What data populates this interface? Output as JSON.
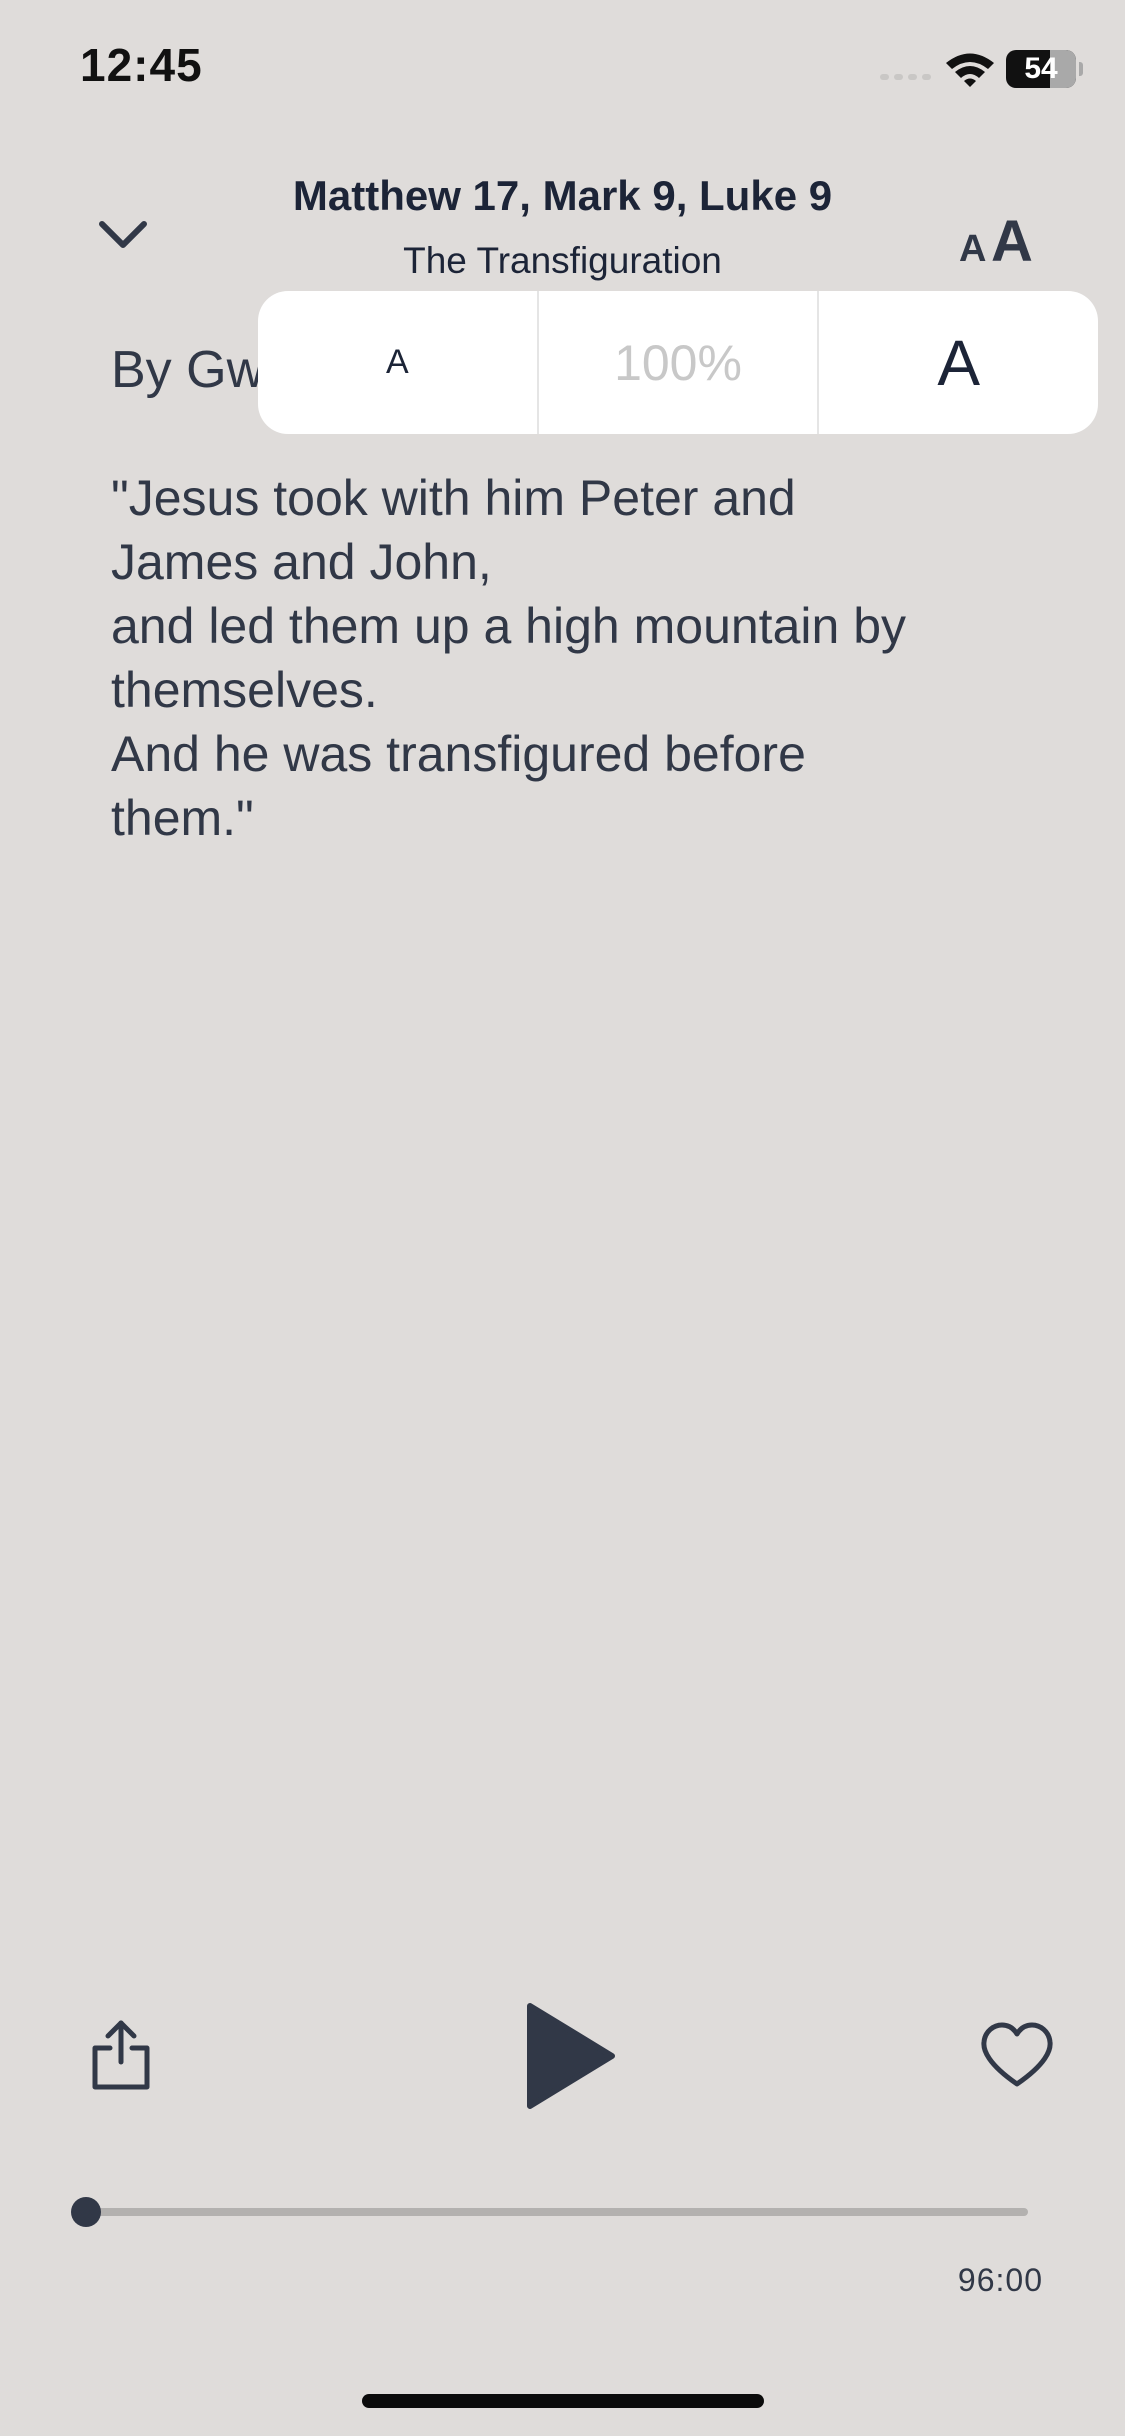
{
  "status_bar": {
    "time": "12:45",
    "battery_level": "54"
  },
  "header": {
    "title": "Matthew 17, Mark 9, Luke 9",
    "subtitle": "The Transfiguration"
  },
  "content": {
    "byline": "By Gw",
    "passage_lines": [
      " \"Jesus took with him Peter and",
      "James and John,",
      "and led them up a high mountain by",
      "themselves.",
      "And he was transfigured before",
      "them.\""
    ]
  },
  "font_popover": {
    "decrease_label": "A",
    "percent_label": "100%",
    "increase_label": "A"
  },
  "player": {
    "progress_fraction": 0,
    "duration": "96:00"
  },
  "icons": {
    "back": "chevron-down-icon",
    "text_size": "text-size-icon",
    "share": "share-icon",
    "play": "play-icon",
    "favorite": "heart-icon"
  },
  "colors": {
    "background": "#dfdcda",
    "text": "#313847",
    "title": "#1c2437",
    "popover_bg": "#ffffff",
    "muted": "#c8c8c8"
  }
}
